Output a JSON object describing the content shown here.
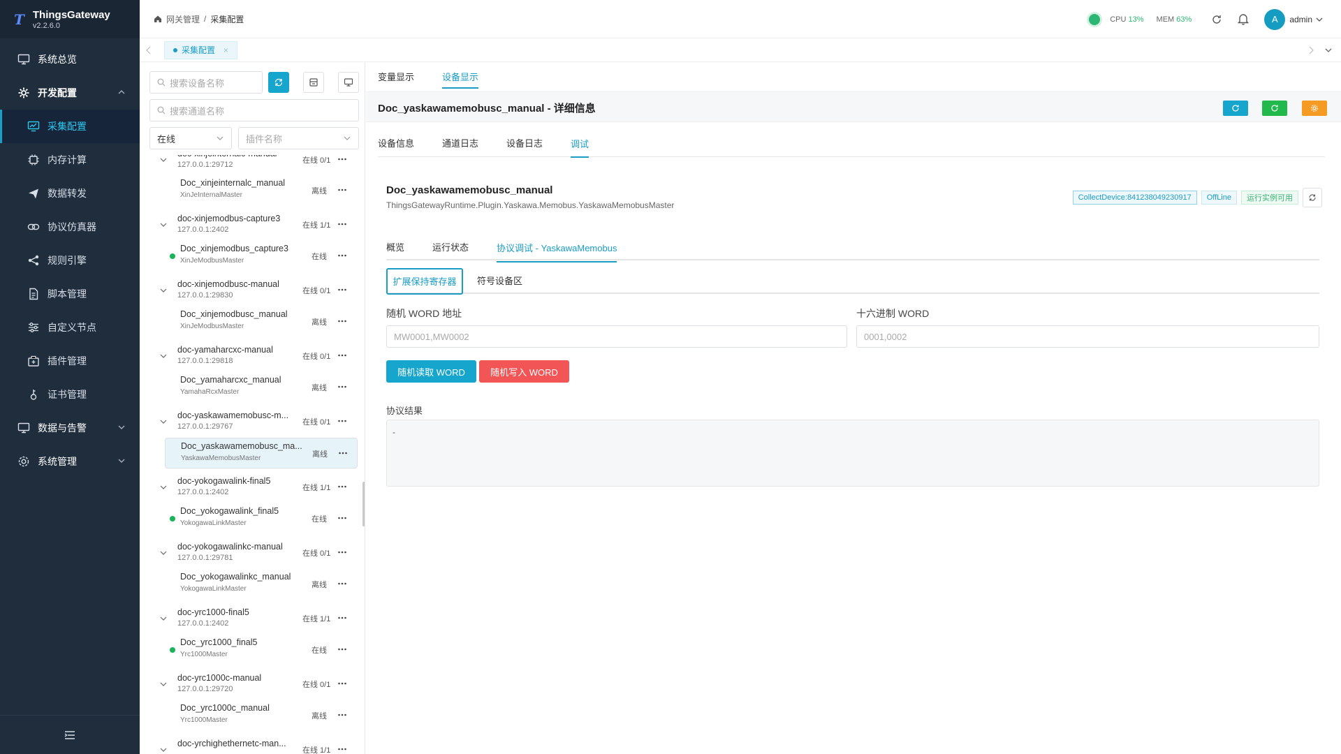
{
  "app": {
    "name": "ThingsGateway",
    "version": "v2.2.6.0"
  },
  "sidebar": {
    "items": [
      {
        "label": "系统总览"
      },
      {
        "label": "开发配置"
      },
      {
        "label": "采集配置"
      },
      {
        "label": "内存计算"
      },
      {
        "label": "数据转发"
      },
      {
        "label": "协议仿真器"
      },
      {
        "label": "规则引擎"
      },
      {
        "label": "脚本管理"
      },
      {
        "label": "自定义节点"
      },
      {
        "label": "插件管理"
      },
      {
        "label": "证书管理"
      },
      {
        "label": "数据与告警"
      },
      {
        "label": "系统管理"
      }
    ]
  },
  "header": {
    "breadcrumb": [
      "网关管理",
      "/",
      "采集配置"
    ],
    "cpu_label": "CPU",
    "cpu_value": "13%",
    "mem_label": "MEM",
    "mem_value": "63%",
    "user": "admin",
    "avatar_letter": "A"
  },
  "tabs": {
    "open": "采集配置"
  },
  "device_panel": {
    "search_device_placeholder": "搜索设备名称",
    "search_channel_placeholder": "搜索通道名称",
    "status_filter": "在线",
    "plugin_placeholder": "插件名称",
    "channels": [
      {
        "name": "doc-xinjeinternalc-manual",
        "address": "127.0.0.1:29712",
        "status": "在线 0/1",
        "device": {
          "name": "Doc_xinjeinternalc_manual",
          "plugin": "XinJeInternalMaster",
          "status": "离线",
          "online": false
        }
      },
      {
        "name": "doc-xinjemodbus-capture3",
        "address": "127.0.0.1:2402",
        "status": "在线 1/1",
        "device": {
          "name": "Doc_xinjemodbus_capture3",
          "plugin": "XinJeModbusMaster",
          "status": "在线",
          "online": true
        }
      },
      {
        "name": "doc-xinjemodbusc-manual",
        "address": "127.0.0.1:29830",
        "status": "在线 0/1",
        "device": {
          "name": "Doc_xinjemodbusc_manual",
          "plugin": "XinJeModbusMaster",
          "status": "离线",
          "online": false
        }
      },
      {
        "name": "doc-yamaharcxc-manual",
        "address": "127.0.0.1:29818",
        "status": "在线 0/1",
        "device": {
          "name": "Doc_yamaharcxc_manual",
          "plugin": "YamahaRcxMaster",
          "status": "离线",
          "online": false
        }
      },
      {
        "name": "doc-yaskawamemobusc-m...",
        "address": "127.0.0.1:29767",
        "status": "在线 0/1",
        "device": {
          "name": "Doc_yaskawamemobusc_ma...",
          "plugin": "YaskawaMemobusMaster",
          "status": "离线",
          "online": false
        }
      },
      {
        "name": "doc-yokogawalink-final5",
        "address": "127.0.0.1:2402",
        "status": "在线 1/1",
        "device": {
          "name": "Doc_yokogawalink_final5",
          "plugin": "YokogawaLinkMaster",
          "status": "在线",
          "online": true
        }
      },
      {
        "name": "doc-yokogawalinkc-manual",
        "address": "127.0.0.1:29781",
        "status": "在线 0/1",
        "device": {
          "name": "Doc_yokogawalinkc_manual",
          "plugin": "YokogawaLinkMaster",
          "status": "离线",
          "online": false
        }
      },
      {
        "name": "doc-yrc1000-final5",
        "address": "127.0.0.1:2402",
        "status": "在线 1/1",
        "device": {
          "name": "Doc_yrc1000_final5",
          "plugin": "Yrc1000Master",
          "status": "在线",
          "online": true
        }
      },
      {
        "name": "doc-yrc1000c-manual",
        "address": "127.0.0.1:29720",
        "status": "在线 0/1",
        "device": {
          "name": "Doc_yrc1000c_manual",
          "plugin": "Yrc1000Master",
          "status": "离线",
          "online": false
        }
      },
      {
        "name": "doc-yrchighethernetc-man...",
        "address": "",
        "status": "在线 1/1",
        "device": null
      }
    ]
  },
  "main": {
    "top_tabs": [
      "变量显示",
      "设备显示"
    ],
    "title": "Doc_yaskawamemobusc_manual - 详细信息",
    "sub_tabs": [
      "设备信息",
      "通道日志",
      "设备日志",
      "调试"
    ],
    "device": {
      "name": "Doc_yaskawamemobusc_manual",
      "class": "ThingsGatewayRuntime.Plugin.Yaskawa.Memobus.YaskawaMemobusMaster",
      "badge_id": "CollectDevice:841238049230917",
      "badge_status": "OffLine",
      "badge_runtime": "运行实例可用"
    },
    "panel_tabs": [
      "概览",
      "运行状态",
      "协议调试 - YaskawaMemobus"
    ],
    "region_tabs": [
      "扩展保持寄存器",
      "符号设备区"
    ],
    "address_label": "随机 WORD 地址",
    "address_placeholder": "MW0001,MW0002",
    "hex_label": "十六进制 WORD",
    "hex_placeholder": "0001,0002",
    "read_button": "随机读取 WORD",
    "write_button": "随机写入 WORD",
    "result_label": "协议结果",
    "result_value": "-"
  },
  "colors": {
    "accent": "#1a9cc4",
    "sidebar_bg": "#1f2d3d",
    "online": "#19b35a",
    "danger": "#f25555",
    "warning": "#f59a23",
    "success": "#21b94b"
  }
}
